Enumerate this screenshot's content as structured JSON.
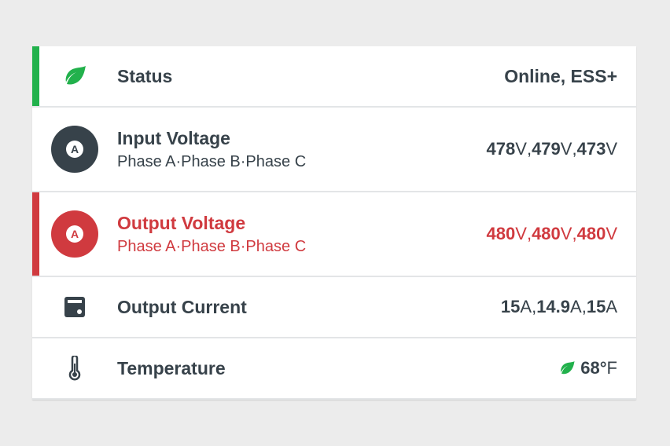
{
  "colors": {
    "ok": "#22b14c",
    "alarm": "#d03a3f",
    "dark": "#37424a"
  },
  "rows": {
    "status": {
      "icon": "leaf-icon",
      "label": "Status",
      "value": "Online, ESS+"
    },
    "input_voltage": {
      "icon": "phase-a-badge-icon",
      "badge": "A",
      "label": "Input Voltage",
      "sublabel": "Phase A·Phase B·Phase C",
      "values": [
        {
          "num": "478",
          "unit": "V"
        },
        {
          "num": "479",
          "unit": "V"
        },
        {
          "num": "473",
          "unit": "V"
        }
      ]
    },
    "output_voltage": {
      "icon": "phase-a-badge-icon",
      "badge": "A",
      "label": "Output Voltage",
      "sublabel": "Phase A·Phase B·Phase C",
      "values": [
        {
          "num": "480",
          "unit": "V"
        },
        {
          "num": "480",
          "unit": "V"
        },
        {
          "num": "480",
          "unit": "V"
        }
      ]
    },
    "output_current": {
      "icon": "meter-icon",
      "label": "Output Current",
      "values": [
        {
          "num": "15",
          "unit": "A"
        },
        {
          "num": "14.9",
          "unit": "A"
        },
        {
          "num": "15",
          "unit": "A"
        }
      ]
    },
    "temperature": {
      "icon": "thermometer-icon",
      "status_icon": "leaf-icon",
      "label": "Temperature",
      "value": {
        "num": "68",
        "degree": "°",
        "unit": "F"
      }
    }
  },
  "separator": ", "
}
